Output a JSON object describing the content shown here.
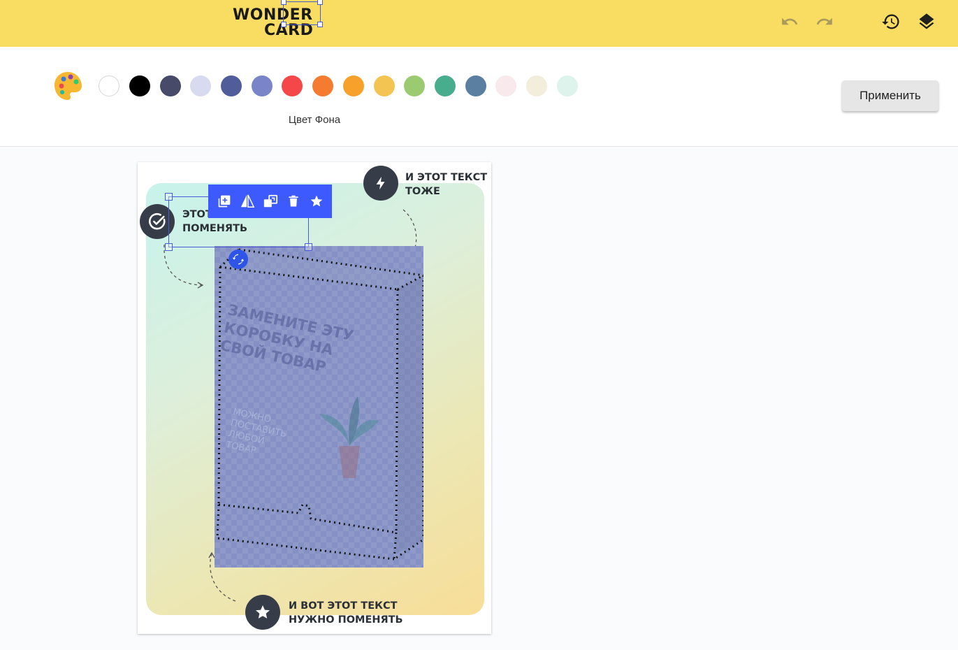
{
  "app": {
    "logo_line1": "WONDER",
    "logo_line2": "CARD",
    "icons": [
      "undo-icon",
      "redo-icon",
      "history-icon",
      "layers-icon"
    ]
  },
  "toolbar": {
    "palette_icon": "palette-icon",
    "swatches": [
      "#ffffff",
      "#000000",
      "#474a68",
      "#d8dbf0",
      "#515c9a",
      "#7a84c8",
      "#f5464a",
      "#f47b30",
      "#f7a02a",
      "#f3c451",
      "#9acb70",
      "#48ad8c",
      "#5b7fa1",
      "#f7e9ec",
      "#f2eedb",
      "#ddf3ec"
    ],
    "label": "Цвет Фона",
    "apply_label": "Применить"
  },
  "card": {
    "caption_top_left": [
      "ЭТОТ ТЕКСТ НУЖНО",
      "ПОМЕНЯТЬ"
    ],
    "caption_top_right": [
      "И ЭТОТ ТЕКСТ",
      "ТОЖЕ"
    ],
    "caption_bottom": [
      "И ВОТ ЭТОТ ТЕКСТ",
      "НУЖНО ПОМЕНЯТЬ"
    ],
    "product_title": [
      "ЗАМЕНИТЕ ЭТУ",
      "КОРОБКУ НА",
      "СВОЙ ТОВАР"
    ],
    "product_subtitle": [
      "МОЖНО",
      "ПОСТАВИТЬ",
      "ЛЮБОЙ",
      "ТОВАР"
    ],
    "element_tools": [
      "duplicate-icon",
      "flip-icon",
      "layer-order-icon",
      "delete-icon",
      "star-icon"
    ],
    "accent": "#3c5afe"
  }
}
